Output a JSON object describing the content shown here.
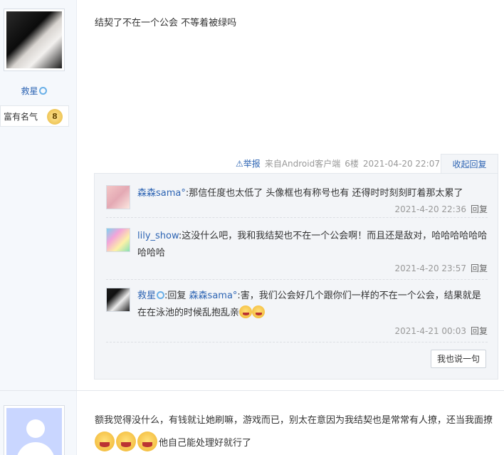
{
  "post1": {
    "username": "救星",
    "fame_label": "富有名气",
    "fame_level": "8",
    "content": "结契了不在一个公会 不等着被绿吗",
    "meta": {
      "report_label": "举报",
      "source": "来自Android客户端",
      "floor": "6楼",
      "time": "2021-04-20 22:07"
    },
    "collapse_label": "收起回复",
    "replies": [
      {
        "name": "森森sama°",
        "text": ":那信任度也太低了 头像框也有称号也有 还得时时刻刻盯着那太累了",
        "time": "2021-4-20 22:36",
        "reply_label": "回复"
      },
      {
        "name": "lily_show",
        "text": ":这没什么吧，我和我结契也不在一个公会啊！而且还是敌对，哈哈哈哈哈哈哈哈哈",
        "time": "2021-4-20 23:57",
        "reply_label": "回复"
      },
      {
        "name": "救星",
        "prefix": ":回复",
        "target": "森森sama°",
        "text": ":害，我们公会好几个跟你们一样的不在一个公会，结果就是在在泳池的时候乱抱乱亲",
        "time": "2021-4-21 00:03",
        "reply_label": "回复"
      }
    ],
    "say_button": "我也说一句"
  },
  "post2": {
    "content_a": "额我觉得没什么，有钱就让她刷嘛，游戏而已，别太在意因为我结契也是常常有人撩，还当我面撩",
    "content_b": "他自己能处理好就行了"
  }
}
